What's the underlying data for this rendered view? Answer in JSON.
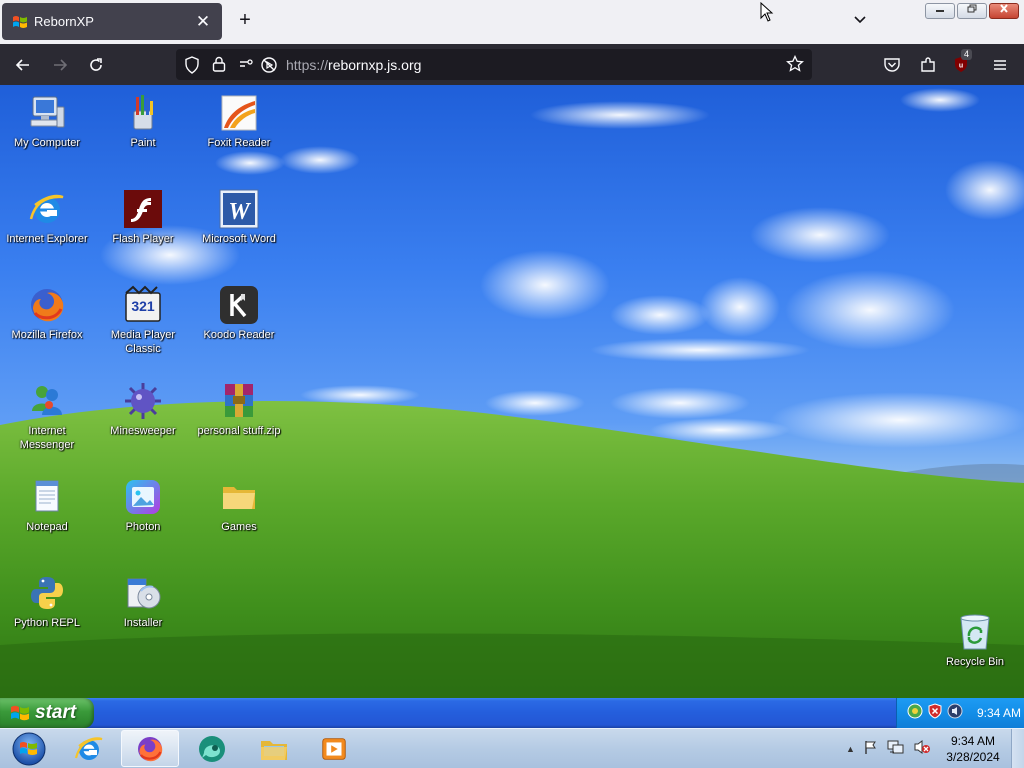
{
  "browser": {
    "tab_title": "RebornXP",
    "tab_close": "✕",
    "new_tab": "+",
    "tab_list": "⌄",
    "url_scheme": "https://",
    "url_host": "rebornxp.js.org",
    "ublock_count": "4",
    "window": {
      "minimize": "—",
      "restore": "❐",
      "close": "✕"
    }
  },
  "desktop": {
    "icons": [
      {
        "label": "My Computer",
        "icon": "computer-icon"
      },
      {
        "label": "Paint",
        "icon": "paint-icon"
      },
      {
        "label": "Foxit Reader",
        "icon": "foxit-reader-icon"
      },
      {
        "label": "Internet Explorer",
        "icon": "internet-explorer-icon"
      },
      {
        "label": "Flash Player",
        "icon": "flash-player-icon"
      },
      {
        "label": "Microsoft Word",
        "icon": "word-icon"
      },
      {
        "label": "Mozilla Firefox",
        "icon": "firefox-icon"
      },
      {
        "label": "Media Player Classic",
        "icon": "media-player-icon"
      },
      {
        "label": "Koodo Reader",
        "icon": "koodo-reader-icon"
      },
      {
        "label": "Internet Messenger",
        "icon": "messenger-icon"
      },
      {
        "label": "Minesweeper",
        "icon": "minesweeper-icon"
      },
      {
        "label": "personal stuff.zip",
        "icon": "winrar-archive-icon"
      },
      {
        "label": "Notepad",
        "icon": "notepad-icon"
      },
      {
        "label": "Photon",
        "icon": "photon-icon"
      },
      {
        "label": "Games",
        "icon": "folder-icon"
      },
      {
        "label": "Python REPL",
        "icon": "python-icon"
      },
      {
        "label": "Installer",
        "icon": "installer-icon"
      },
      {
        "label": "Recycle Bin",
        "icon": "recycle-bin-icon"
      }
    ],
    "media_player_badge": "321"
  },
  "xp_taskbar": {
    "start_label": "start",
    "clock": "9:34 AM"
  },
  "win7_taskbar": {
    "time": "9:34 AM",
    "date": "3/28/2024",
    "tray_arrow": "▲"
  },
  "colors": {
    "xp_blue": "#245edc",
    "xp_start_green": "#3a9a3a",
    "firefox_dark": "#2b2a33",
    "tab_bg": "#42414d"
  }
}
